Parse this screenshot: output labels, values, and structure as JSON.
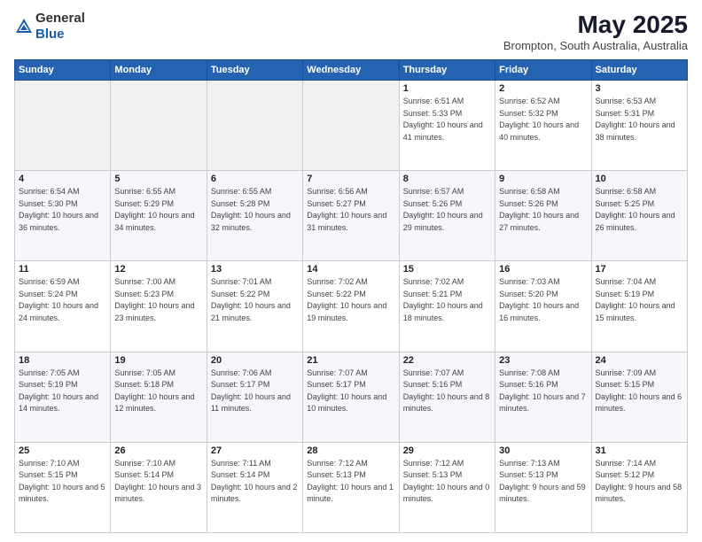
{
  "header": {
    "logo": {
      "general": "General",
      "blue": "Blue"
    },
    "title": "May 2025",
    "location": "Brompton, South Australia, Australia"
  },
  "weekdays": [
    "Sunday",
    "Monday",
    "Tuesday",
    "Wednesday",
    "Thursday",
    "Friday",
    "Saturday"
  ],
  "weeks": [
    [
      {
        "day": "",
        "sunrise": "",
        "sunset": "",
        "daylight": ""
      },
      {
        "day": "",
        "sunrise": "",
        "sunset": "",
        "daylight": ""
      },
      {
        "day": "",
        "sunrise": "",
        "sunset": "",
        "daylight": ""
      },
      {
        "day": "",
        "sunrise": "",
        "sunset": "",
        "daylight": ""
      },
      {
        "day": "1",
        "sunrise": "Sunrise: 6:51 AM",
        "sunset": "Sunset: 5:33 PM",
        "daylight": "Daylight: 10 hours and 41 minutes."
      },
      {
        "day": "2",
        "sunrise": "Sunrise: 6:52 AM",
        "sunset": "Sunset: 5:32 PM",
        "daylight": "Daylight: 10 hours and 40 minutes."
      },
      {
        "day": "3",
        "sunrise": "Sunrise: 6:53 AM",
        "sunset": "Sunset: 5:31 PM",
        "daylight": "Daylight: 10 hours and 38 minutes."
      }
    ],
    [
      {
        "day": "4",
        "sunrise": "Sunrise: 6:54 AM",
        "sunset": "Sunset: 5:30 PM",
        "daylight": "Daylight: 10 hours and 36 minutes."
      },
      {
        "day": "5",
        "sunrise": "Sunrise: 6:55 AM",
        "sunset": "Sunset: 5:29 PM",
        "daylight": "Daylight: 10 hours and 34 minutes."
      },
      {
        "day": "6",
        "sunrise": "Sunrise: 6:55 AM",
        "sunset": "Sunset: 5:28 PM",
        "daylight": "Daylight: 10 hours and 32 minutes."
      },
      {
        "day": "7",
        "sunrise": "Sunrise: 6:56 AM",
        "sunset": "Sunset: 5:27 PM",
        "daylight": "Daylight: 10 hours and 31 minutes."
      },
      {
        "day": "8",
        "sunrise": "Sunrise: 6:57 AM",
        "sunset": "Sunset: 5:26 PM",
        "daylight": "Daylight: 10 hours and 29 minutes."
      },
      {
        "day": "9",
        "sunrise": "Sunrise: 6:58 AM",
        "sunset": "Sunset: 5:26 PM",
        "daylight": "Daylight: 10 hours and 27 minutes."
      },
      {
        "day": "10",
        "sunrise": "Sunrise: 6:58 AM",
        "sunset": "Sunset: 5:25 PM",
        "daylight": "Daylight: 10 hours and 26 minutes."
      }
    ],
    [
      {
        "day": "11",
        "sunrise": "Sunrise: 6:59 AM",
        "sunset": "Sunset: 5:24 PM",
        "daylight": "Daylight: 10 hours and 24 minutes."
      },
      {
        "day": "12",
        "sunrise": "Sunrise: 7:00 AM",
        "sunset": "Sunset: 5:23 PM",
        "daylight": "Daylight: 10 hours and 23 minutes."
      },
      {
        "day": "13",
        "sunrise": "Sunrise: 7:01 AM",
        "sunset": "Sunset: 5:22 PM",
        "daylight": "Daylight: 10 hours and 21 minutes."
      },
      {
        "day": "14",
        "sunrise": "Sunrise: 7:02 AM",
        "sunset": "Sunset: 5:22 PM",
        "daylight": "Daylight: 10 hours and 19 minutes."
      },
      {
        "day": "15",
        "sunrise": "Sunrise: 7:02 AM",
        "sunset": "Sunset: 5:21 PM",
        "daylight": "Daylight: 10 hours and 18 minutes."
      },
      {
        "day": "16",
        "sunrise": "Sunrise: 7:03 AM",
        "sunset": "Sunset: 5:20 PM",
        "daylight": "Daylight: 10 hours and 16 minutes."
      },
      {
        "day": "17",
        "sunrise": "Sunrise: 7:04 AM",
        "sunset": "Sunset: 5:19 PM",
        "daylight": "Daylight: 10 hours and 15 minutes."
      }
    ],
    [
      {
        "day": "18",
        "sunrise": "Sunrise: 7:05 AM",
        "sunset": "Sunset: 5:19 PM",
        "daylight": "Daylight: 10 hours and 14 minutes."
      },
      {
        "day": "19",
        "sunrise": "Sunrise: 7:05 AM",
        "sunset": "Sunset: 5:18 PM",
        "daylight": "Daylight: 10 hours and 12 minutes."
      },
      {
        "day": "20",
        "sunrise": "Sunrise: 7:06 AM",
        "sunset": "Sunset: 5:17 PM",
        "daylight": "Daylight: 10 hours and 11 minutes."
      },
      {
        "day": "21",
        "sunrise": "Sunrise: 7:07 AM",
        "sunset": "Sunset: 5:17 PM",
        "daylight": "Daylight: 10 hours and 10 minutes."
      },
      {
        "day": "22",
        "sunrise": "Sunrise: 7:07 AM",
        "sunset": "Sunset: 5:16 PM",
        "daylight": "Daylight: 10 hours and 8 minutes."
      },
      {
        "day": "23",
        "sunrise": "Sunrise: 7:08 AM",
        "sunset": "Sunset: 5:16 PM",
        "daylight": "Daylight: 10 hours and 7 minutes."
      },
      {
        "day": "24",
        "sunrise": "Sunrise: 7:09 AM",
        "sunset": "Sunset: 5:15 PM",
        "daylight": "Daylight: 10 hours and 6 minutes."
      }
    ],
    [
      {
        "day": "25",
        "sunrise": "Sunrise: 7:10 AM",
        "sunset": "Sunset: 5:15 PM",
        "daylight": "Daylight: 10 hours and 5 minutes."
      },
      {
        "day": "26",
        "sunrise": "Sunrise: 7:10 AM",
        "sunset": "Sunset: 5:14 PM",
        "daylight": "Daylight: 10 hours and 3 minutes."
      },
      {
        "day": "27",
        "sunrise": "Sunrise: 7:11 AM",
        "sunset": "Sunset: 5:14 PM",
        "daylight": "Daylight: 10 hours and 2 minutes."
      },
      {
        "day": "28",
        "sunrise": "Sunrise: 7:12 AM",
        "sunset": "Sunset: 5:13 PM",
        "daylight": "Daylight: 10 hours and 1 minute."
      },
      {
        "day": "29",
        "sunrise": "Sunrise: 7:12 AM",
        "sunset": "Sunset: 5:13 PM",
        "daylight": "Daylight: 10 hours and 0 minutes."
      },
      {
        "day": "30",
        "sunrise": "Sunrise: 7:13 AM",
        "sunset": "Sunset: 5:13 PM",
        "daylight": "Daylight: 9 hours and 59 minutes."
      },
      {
        "day": "31",
        "sunrise": "Sunrise: 7:14 AM",
        "sunset": "Sunset: 5:12 PM",
        "daylight": "Daylight: 9 hours and 58 minutes."
      }
    ]
  ]
}
